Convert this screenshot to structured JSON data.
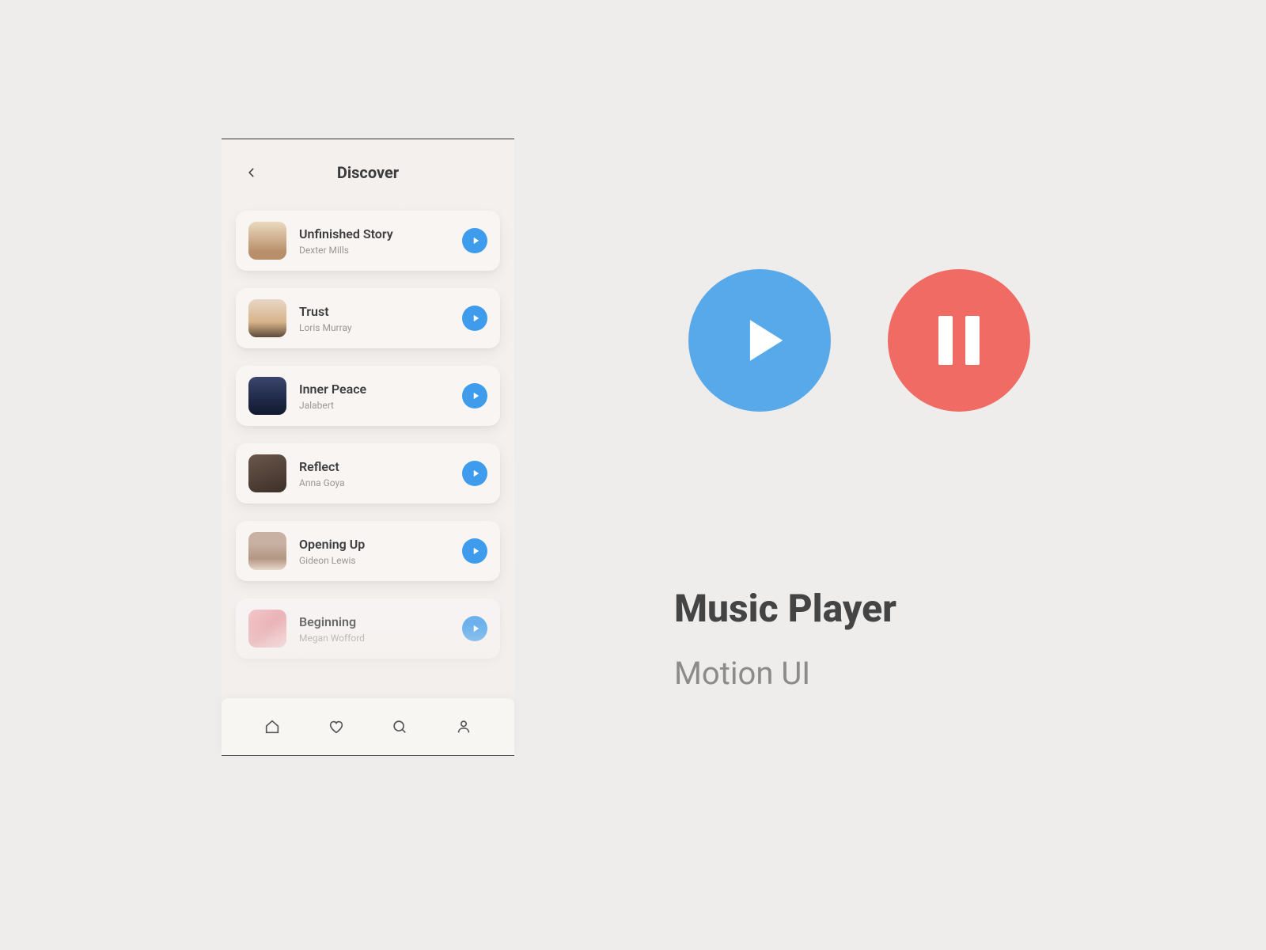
{
  "colors": {
    "blue": "#57a9ea",
    "blue_dark": "#3f9cec",
    "red": "#ef6b63",
    "bg": "#eeedec",
    "text_dark": "#444444",
    "text_muted": "#8d8b88"
  },
  "phone": {
    "header_title": "Discover",
    "tracks": [
      {
        "title": "Unfinished Story",
        "artist": "Dexter Mills"
      },
      {
        "title": "Trust",
        "artist": "Loris Murray"
      },
      {
        "title": "Inner Peace",
        "artist": "Jalabert"
      },
      {
        "title": "Reflect",
        "artist": "Anna Goya"
      },
      {
        "title": "Opening Up",
        "artist": "Gideon Lewis"
      },
      {
        "title": "Beginning",
        "artist": "Megan Wofford"
      }
    ],
    "nav": [
      "home",
      "favorites",
      "search",
      "profile"
    ]
  },
  "right": {
    "title": "Music Player",
    "subtitle": "Motion UI"
  }
}
